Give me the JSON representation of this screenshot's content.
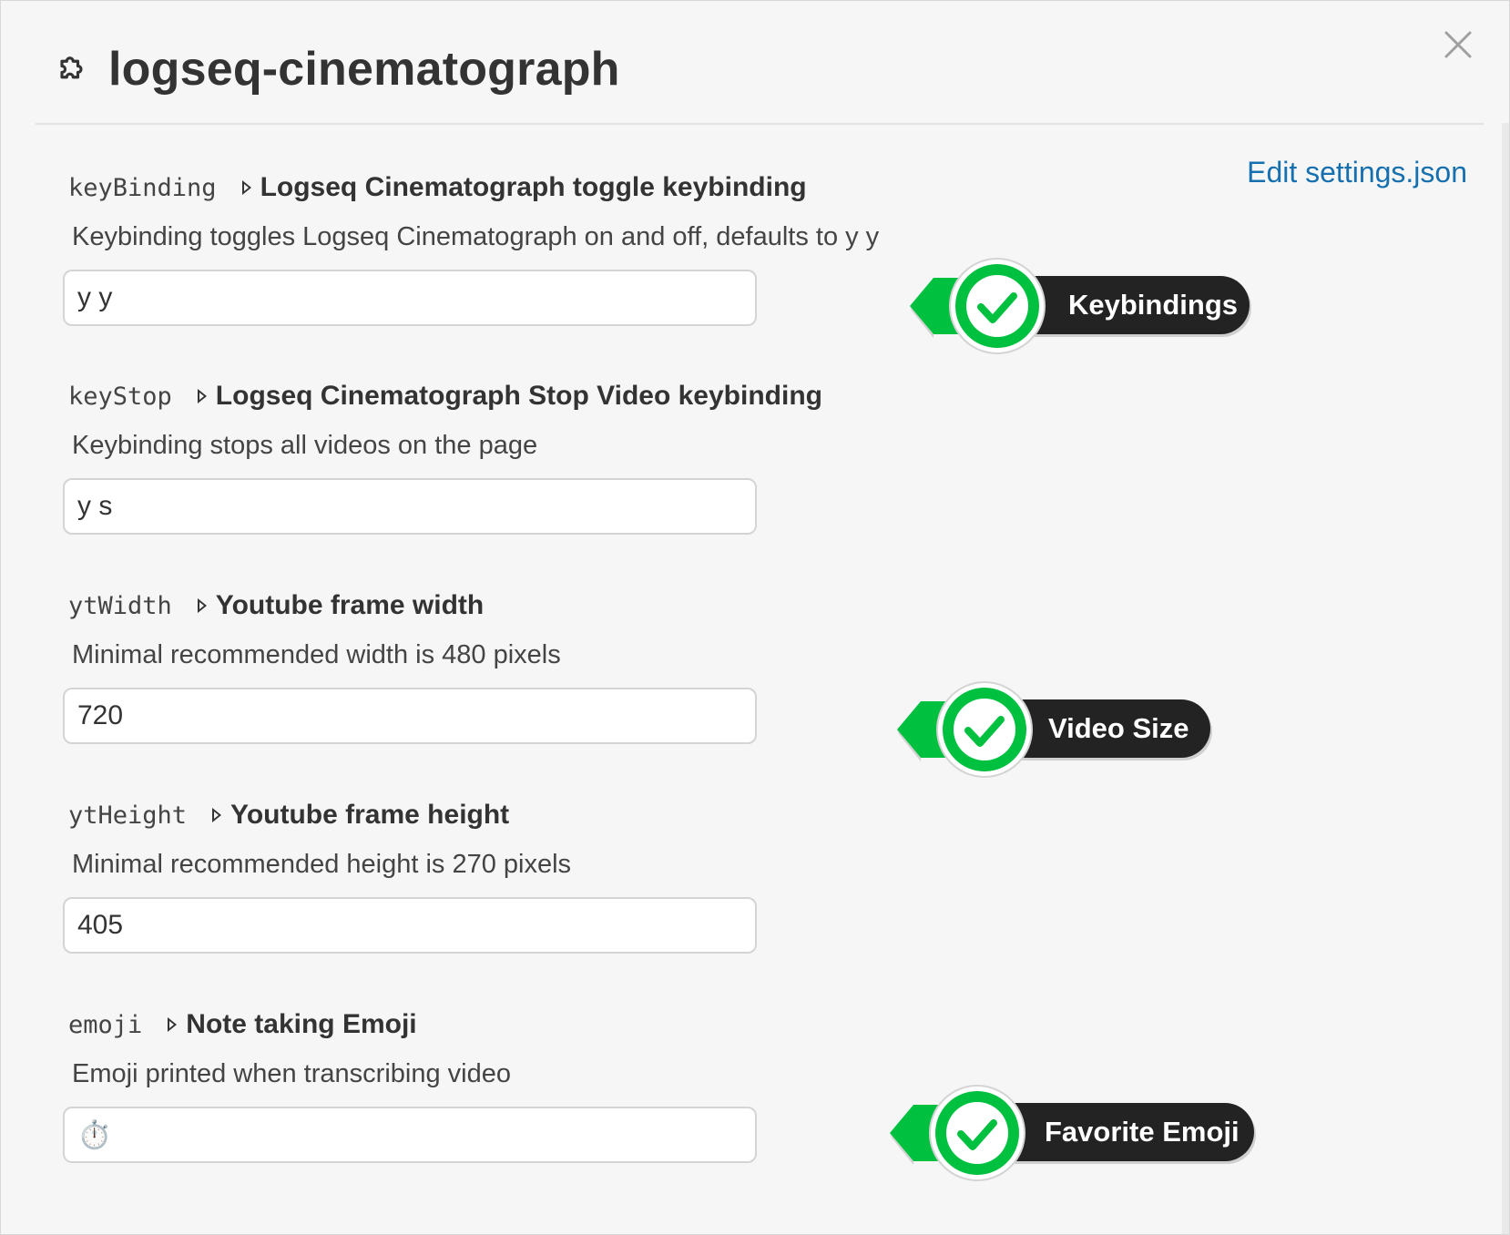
{
  "header": {
    "title": "logseq-cinematograph",
    "edit_link": "Edit settings.json"
  },
  "settings": [
    {
      "key": "keyBinding",
      "label": "Logseq Cinematograph toggle keybinding",
      "description": "Keybinding toggles Logseq Cinematograph on and off, defaults to y y",
      "value": "y y"
    },
    {
      "key": "keyStop",
      "label": "Logseq Cinematograph Stop Video keybinding",
      "description": "Keybinding stops all videos on the page",
      "value": "y s"
    },
    {
      "key": "ytWidth",
      "label": "Youtube frame width",
      "description": "Minimal recommended width is 480 pixels",
      "value": "720"
    },
    {
      "key": "ytHeight",
      "label": "Youtube frame height",
      "description": "Minimal recommended height is 270 pixels",
      "value": "405"
    },
    {
      "key": "emoji",
      "label": "Note taking Emoji",
      "description": "Emoji printed when transcribing video",
      "value": "⏱️"
    }
  ],
  "badges": {
    "keybindings": "Keybindings",
    "video_size": "Video Size",
    "favorite_emoji": "Favorite Emoji"
  },
  "colors": {
    "accent_link": "#1670b0",
    "badge_green": "#00c040",
    "badge_dark": "#232323"
  }
}
